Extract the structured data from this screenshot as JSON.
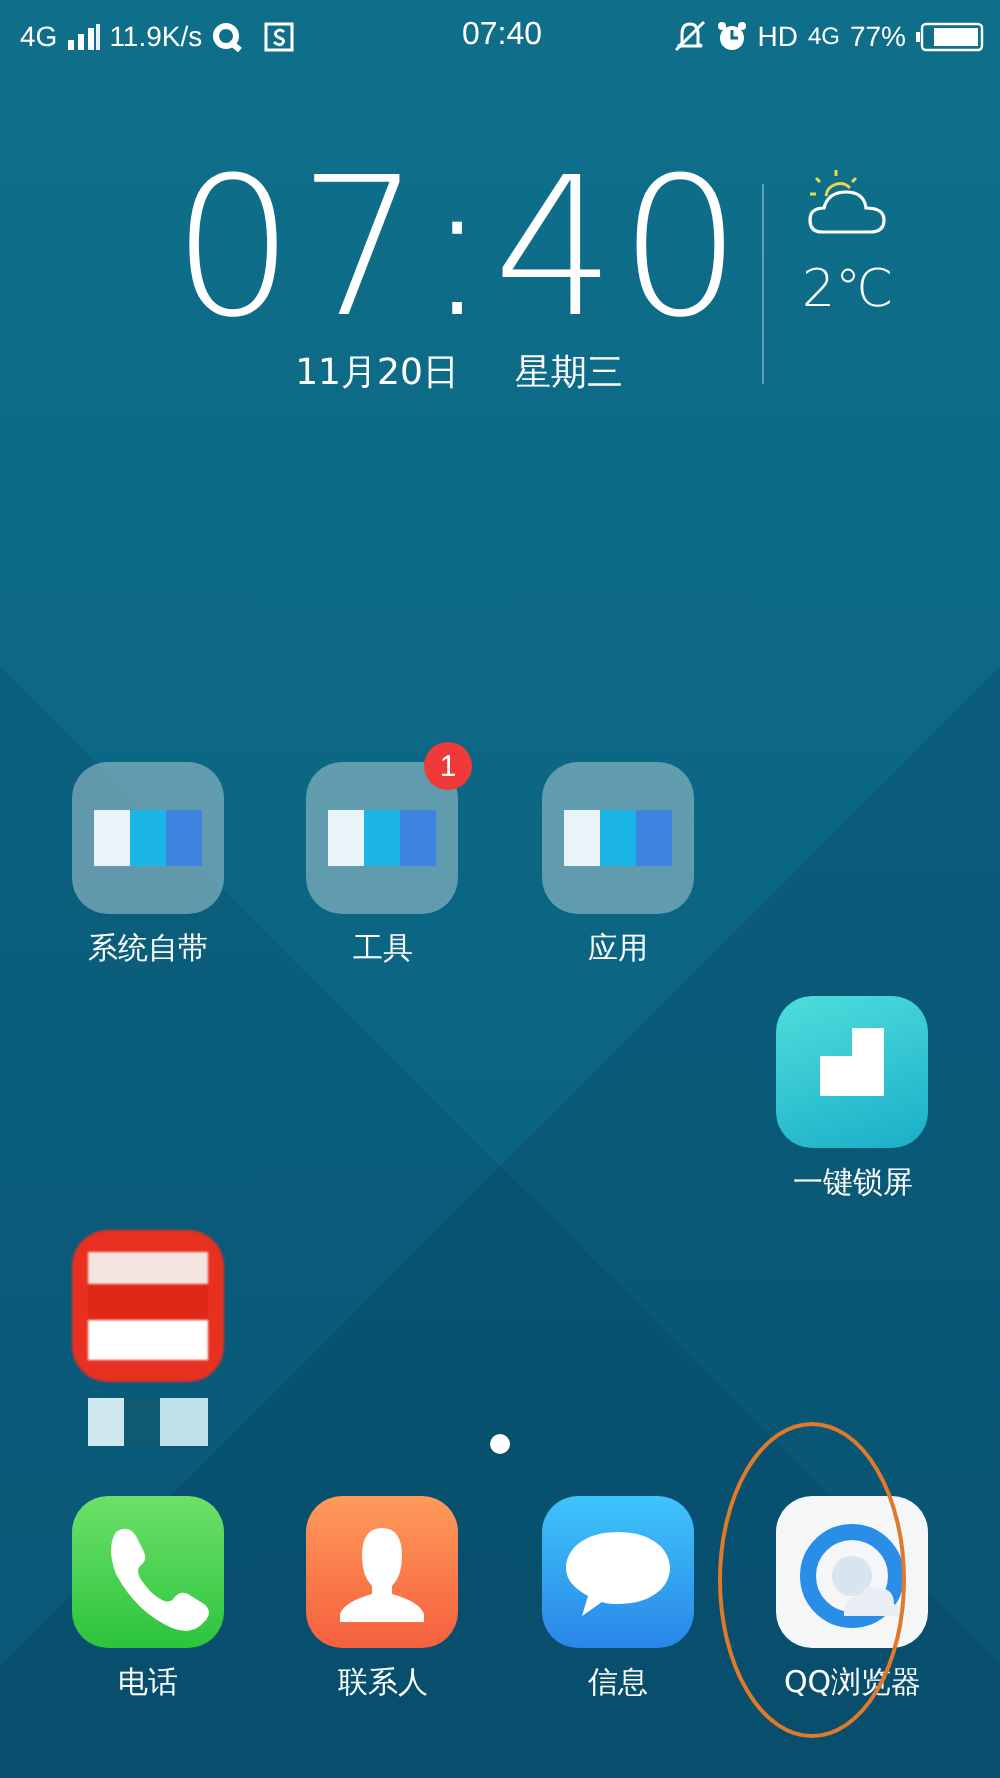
{
  "status_bar": {
    "network": "4G",
    "speed": "11.9K/s",
    "time": "07:40",
    "hd": "HD",
    "network_right": "4G",
    "battery": "77%"
  },
  "clock": {
    "time": "07:40",
    "date": "11月20日",
    "weekday": "星期三"
  },
  "weather": {
    "temperature": "2℃"
  },
  "home_rows": [
    [
      {
        "kind": "folder",
        "label": "系统自带"
      },
      {
        "kind": "folder",
        "label": "工具",
        "badge": "1"
      },
      {
        "kind": "folder",
        "label": "应用"
      },
      {
        "kind": "empty"
      }
    ],
    [
      {
        "kind": "empty"
      },
      {
        "kind": "empty"
      },
      {
        "kind": "empty"
      },
      {
        "kind": "lock",
        "label": "一键锁屏"
      }
    ],
    [
      {
        "kind": "blurred"
      },
      {
        "kind": "empty"
      },
      {
        "kind": "empty"
      },
      {
        "kind": "empty"
      }
    ]
  ],
  "page_dots": [
    {
      "selected": true
    }
  ],
  "dock": [
    {
      "kind": "phone",
      "label": "电话",
      "highlighted": false
    },
    {
      "kind": "contacts",
      "label": "联系人",
      "highlighted": false
    },
    {
      "kind": "messages",
      "label": "信息",
      "highlighted": false
    },
    {
      "kind": "browser",
      "label": "QQ浏览器",
      "highlighted": true
    }
  ]
}
